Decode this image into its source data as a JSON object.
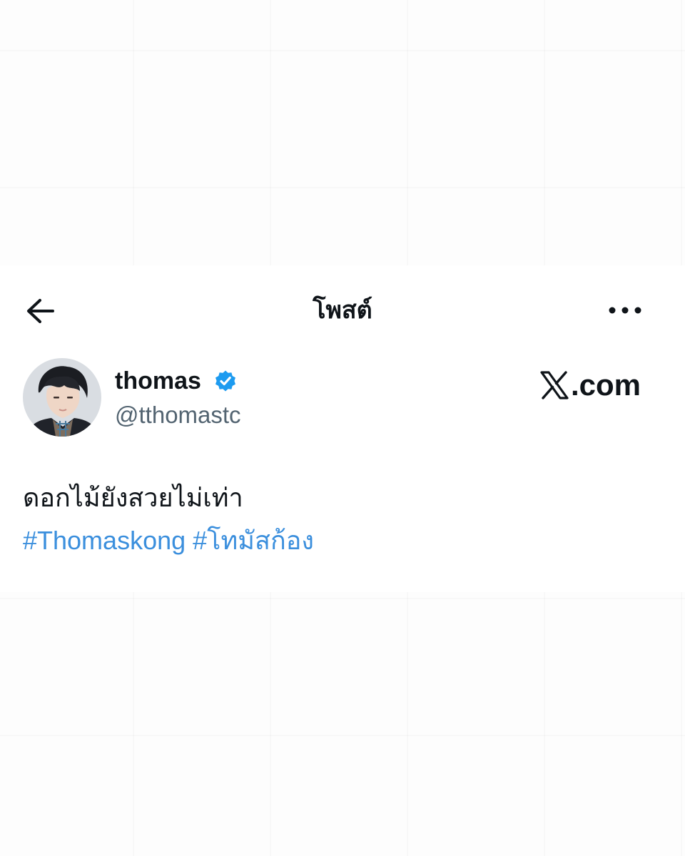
{
  "header": {
    "title": "โพสต์",
    "back_icon": "arrow-left-icon",
    "more_icon": "more-horizontal-icon"
  },
  "author": {
    "display_name": "thomas",
    "handle": "@tthomastc",
    "verified": true,
    "verified_color": "#1d9bf0"
  },
  "brand": {
    "icon": "x-logo-icon",
    "text": ".com"
  },
  "post": {
    "text": "ดอกไม้ยังสวยไม่เท่า",
    "hashtags": [
      "#Thomaskong",
      "#โทมัสก้อง"
    ],
    "hashtag_color": "#3b8fdd"
  }
}
